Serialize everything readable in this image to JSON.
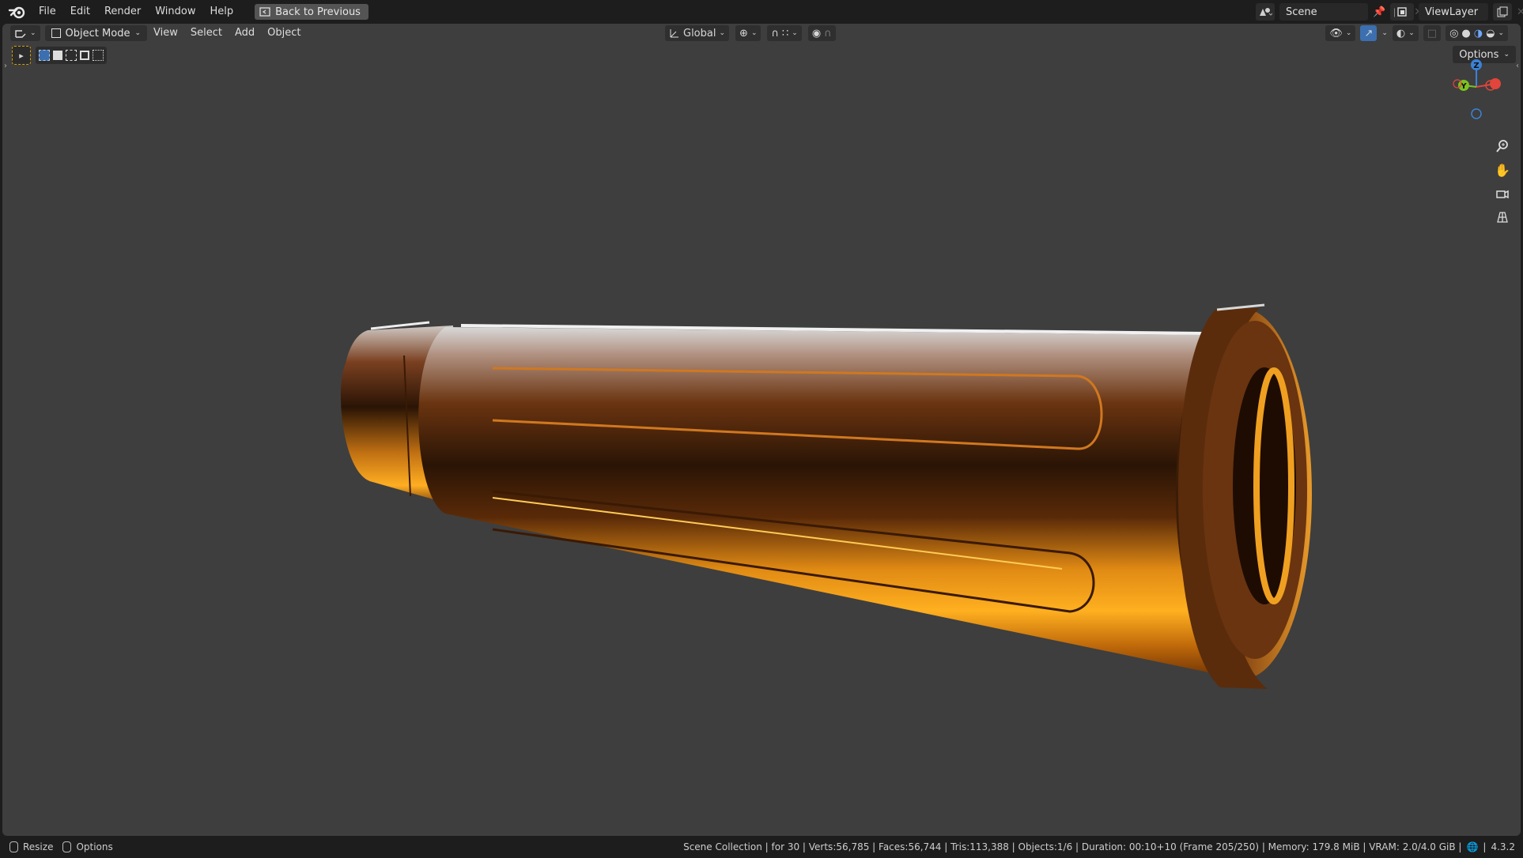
{
  "menu": {
    "file": "File",
    "edit": "Edit",
    "render": "Render",
    "window": "Window",
    "help": "Help",
    "back_to_previous": "Back to Previous"
  },
  "scene": {
    "name": "Scene"
  },
  "view_layer": {
    "name": "ViewLayer"
  },
  "viewport_header": {
    "mode": "Object Mode",
    "view": "View",
    "select": "Select",
    "add": "Add",
    "object": "Object",
    "orientation": "Global",
    "options": "Options"
  },
  "gizmo": {
    "z": "Z",
    "y": "Y"
  },
  "status": {
    "resize": "Resize",
    "options": "Options",
    "stats": "Scene Collection | for 30 | Verts:56,785 | Faces:56,744 | Tris:113,388 | Objects:1/6 | Duration: 00:10+10 (Frame 205/250) | Memory: 179.8 MiB | VRAM: 2.0/4.0 GiB |",
    "version": "4.3.2"
  },
  "colors": {
    "viewport_bg": "#3e3e3e",
    "chrome_bg": "#1d1d1d",
    "gold_highlight": "#f0a020",
    "axis_x": "#e2453b",
    "axis_y": "#7cc220",
    "axis_z": "#3b82d8"
  }
}
